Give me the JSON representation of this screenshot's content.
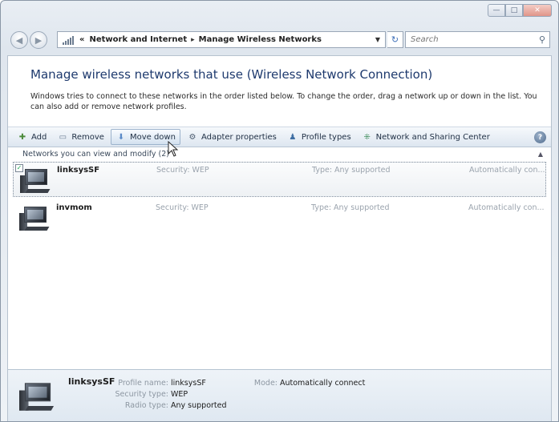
{
  "window": {
    "caption": {
      "minimize": "—",
      "maximize": "□",
      "close": "✕"
    }
  },
  "navbar": {
    "back_icon": "back-arrow-icon",
    "forward_icon": "forward-arrow-icon",
    "breadcrumb_prefix": "«",
    "breadcrumb": [
      "Network and Internet",
      "Manage Wireless Networks"
    ],
    "separator": "▸",
    "search_placeholder": "Search"
  },
  "main": {
    "heading": "Manage wireless networks that use (Wireless Network Connection)",
    "description": "Windows tries to connect to these networks in the order listed below. To change the order, drag a network up or down in the list. You can also add or remove network profiles."
  },
  "toolbar": {
    "items": [
      {
        "label": "Add",
        "icon": "add-network-icon"
      },
      {
        "label": "Remove",
        "icon": "remove-network-icon"
      },
      {
        "label": "Move down",
        "icon": "move-down-icon"
      },
      {
        "label": "Adapter properties",
        "icon": "adapter-icon"
      },
      {
        "label": "Profile types",
        "icon": "profile-types-icon"
      },
      {
        "label": "Network and Sharing Center",
        "icon": "sharing-center-icon"
      }
    ],
    "help_label": "?"
  },
  "list": {
    "group_header": "Networks you can view and modify (2)",
    "networks": [
      {
        "name": "linksysSF",
        "security": "Security: WEP",
        "type": "Type: Any supported",
        "mode": "Automatically con...",
        "selected": true
      },
      {
        "name": "invmom",
        "security": "Security: WEP",
        "type": "Type: Any supported",
        "mode": "Automatically con...",
        "selected": false
      }
    ]
  },
  "details": {
    "name": "linksysSF",
    "profile_name_label": "Profile name:",
    "profile_name_value": "linksysSF",
    "security_type_label": "Security type:",
    "security_type_value": "WEP",
    "radio_type_label": "Radio type:",
    "radio_type_value": "Any supported",
    "mode_label": "Mode:",
    "mode_value": "Automatically connect"
  },
  "colors": {
    "heading": "#1e3a6e",
    "accent": "#3e6fb8",
    "muted": "#9aa3ad"
  }
}
